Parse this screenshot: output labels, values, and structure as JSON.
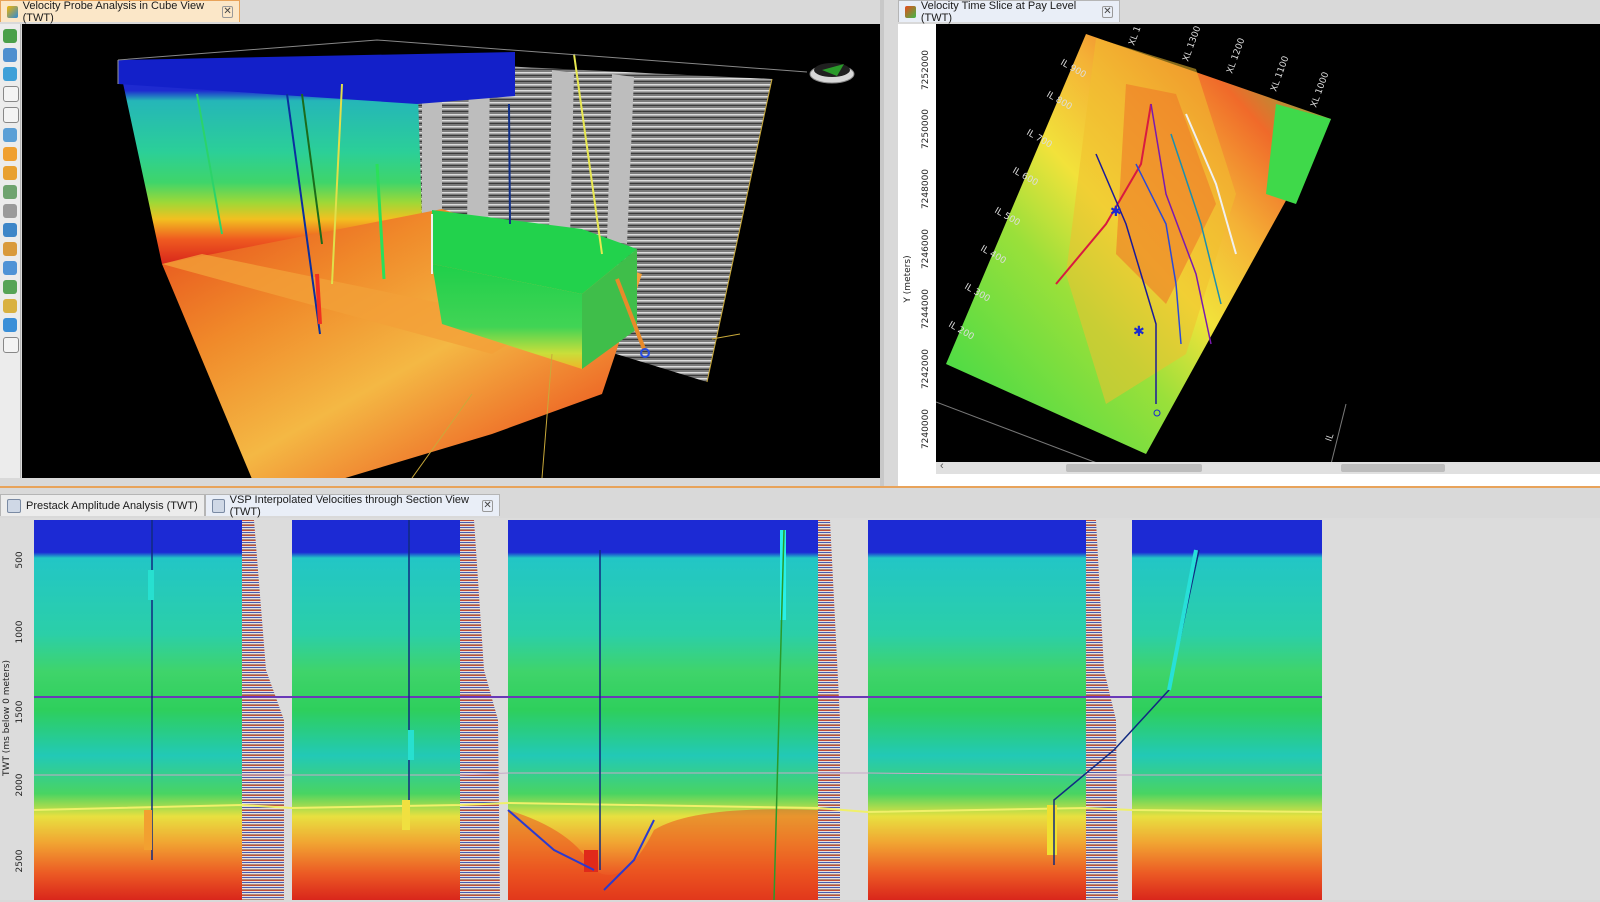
{
  "top_left_tab": {
    "label": "Velocity Probe Analysis in Cube View (TWT)"
  },
  "top_right_tab": {
    "label": "Velocity Time Slice at Pay Level (TWT)"
  },
  "bottom_tabs": [
    {
      "label": "Prestack Amplitude Analysis (TWT)"
    },
    {
      "label": "VSP Interpolated Velocities through Section View (TWT)"
    }
  ],
  "map": {
    "ylabel": "Y (meters)",
    "y_ticks": [
      "7252000",
      "7250000",
      "7248000",
      "7246000",
      "7244000",
      "7242000",
      "7240000"
    ],
    "il_labels": [
      "IL 900",
      "IL 800",
      "IL 700",
      "IL 600",
      "IL 500",
      "IL 400",
      "IL 300",
      "IL 200"
    ],
    "xl_labels": [
      "XL 1",
      "XL 1300",
      "XL 1200",
      "XL 1100",
      "XL 1000"
    ],
    "edge_label": "IL"
  },
  "section": {
    "ylabel": "TWT (ms below 0 meters)",
    "y_ticks": [
      "500",
      "1000",
      "1500",
      "2000",
      "2500"
    ]
  },
  "colors": {
    "velocity_low": "#1a2fd6",
    "velocity_mid": "#1ec94a",
    "velocity_high": "#e0301e",
    "accent": "#e8a35a"
  }
}
